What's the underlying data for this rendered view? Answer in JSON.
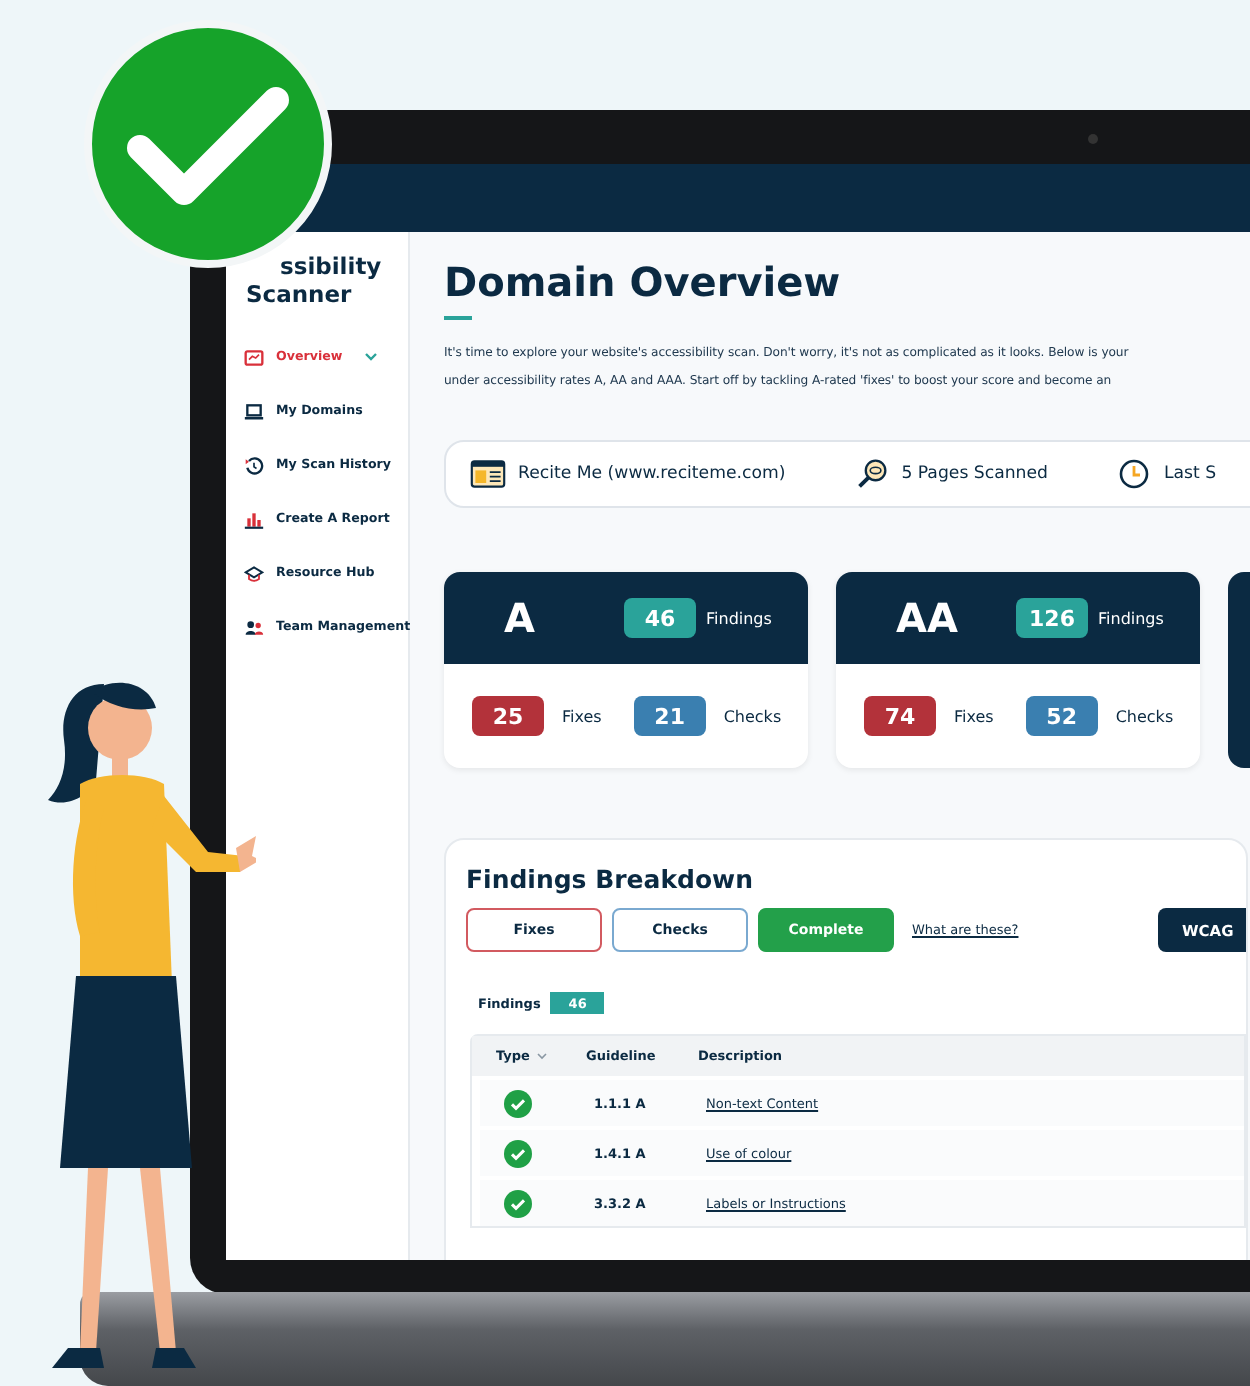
{
  "sidebar": {
    "title_lines": [
      "ssibility",
      "Scanner"
    ],
    "items": [
      {
        "label": "Overview",
        "selected": true
      },
      {
        "label": "My Domains",
        "selected": false
      },
      {
        "label": "My Scan History",
        "selected": false
      },
      {
        "label": "Create A Report",
        "selected": false
      },
      {
        "label": "Resource Hub",
        "selected": false
      },
      {
        "label": "Team Management",
        "selected": false
      }
    ]
  },
  "page": {
    "title": "Domain Overview",
    "intro_lines": [
      "It's time to explore your website's accessibility scan. Don't worry, it's not as complicated as it looks. Below is your",
      "under accessibility rates A, AA and AAA. Start off by tackling A-rated 'fixes' to boost your score and become an"
    ]
  },
  "info_bar": [
    {
      "kind": "site",
      "text": "Recite Me (www.reciteme.com)"
    },
    {
      "kind": "pages",
      "text": "5 Pages Scanned"
    },
    {
      "kind": "time",
      "text": "Last S"
    }
  ],
  "level_cards": [
    {
      "level": "A",
      "findings": "46",
      "findings_label": "Findings",
      "fixes": "25",
      "fixes_label": "Fixes",
      "checks": "21",
      "checks_label": "Checks"
    },
    {
      "level": "AA",
      "findings": "126",
      "findings_label": "Findings",
      "fixes": "74",
      "fixes_label": "Fixes",
      "checks": "52",
      "checks_label": "Checks"
    }
  ],
  "breakdown": {
    "title": "Findings Breakdown",
    "filters": [
      {
        "label": "Fixes",
        "kind": "fixes",
        "selected": false
      },
      {
        "label": "Checks",
        "kind": "checks",
        "selected": false
      },
      {
        "label": "Complete",
        "kind": "complete",
        "selected": true
      }
    ],
    "help_link": "What are these?",
    "standard_button": "WCAG",
    "findings_label": "Findings",
    "findings_count": "46",
    "columns": [
      "Type",
      "Guideline",
      "Description"
    ],
    "rows": [
      {
        "kind": "complete",
        "guideline": "1.1.1 A",
        "description": "Non-text Content"
      },
      {
        "kind": "complete",
        "guideline": "1.4.1 A",
        "description": "Use of colour"
      },
      {
        "kind": "complete",
        "guideline": "3.3.2 A",
        "description": "Labels or Instructions"
      }
    ]
  }
}
